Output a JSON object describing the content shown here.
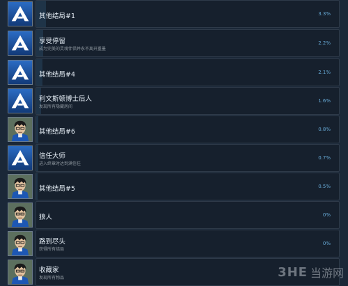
{
  "achievements": [
    {
      "name": "其他结局#1",
      "description": "",
      "percent": "3.3%",
      "percent_value": 3.3,
      "icon": "steam-arrow-icon"
    },
    {
      "name": "享受停留",
      "description": "成为完美的灵魂伴侣并永不离开重墨",
      "percent": "2.2%",
      "percent_value": 2.2,
      "icon": "steam-arrow-icon"
    },
    {
      "name": "其他结局#4",
      "description": "",
      "percent": "2.1%",
      "percent_value": 2.1,
      "icon": "steam-arrow-icon"
    },
    {
      "name": "利文斯顿博士后人",
      "description": "发现所有隐藏房间",
      "percent": "1.6%",
      "percent_value": 1.6,
      "icon": "steam-arrow-icon"
    },
    {
      "name": "其他结局#6",
      "description": "",
      "percent": "0.8%",
      "percent_value": 0.8,
      "icon": "character-portrait-icon"
    },
    {
      "name": "信任大师",
      "description": "进入终章时达到满信任",
      "percent": "0.7%",
      "percent_value": 0.7,
      "icon": "steam-arrow-icon"
    },
    {
      "name": "其他结局#5",
      "description": "",
      "percent": "0.5%",
      "percent_value": 0.5,
      "icon": "character-portrait-icon"
    },
    {
      "name": "狼人",
      "description": "",
      "percent": "0%",
      "percent_value": 0,
      "icon": "character-portrait-icon"
    },
    {
      "name": "路到尽头",
      "description": "获得所有结局",
      "percent": "0%",
      "percent_value": 0,
      "icon": "character-portrait-icon"
    },
    {
      "name": "收藏家",
      "description": "发现所有物品",
      "percent": "",
      "percent_value": 0,
      "icon": "character-portrait-icon"
    }
  ],
  "watermark": {
    "logo": "3HE",
    "text": "当游网"
  },
  "colors": {
    "background": "#1b2838",
    "card": "#16202d",
    "fill": "#1f3448",
    "percent": "#66a8d4"
  }
}
